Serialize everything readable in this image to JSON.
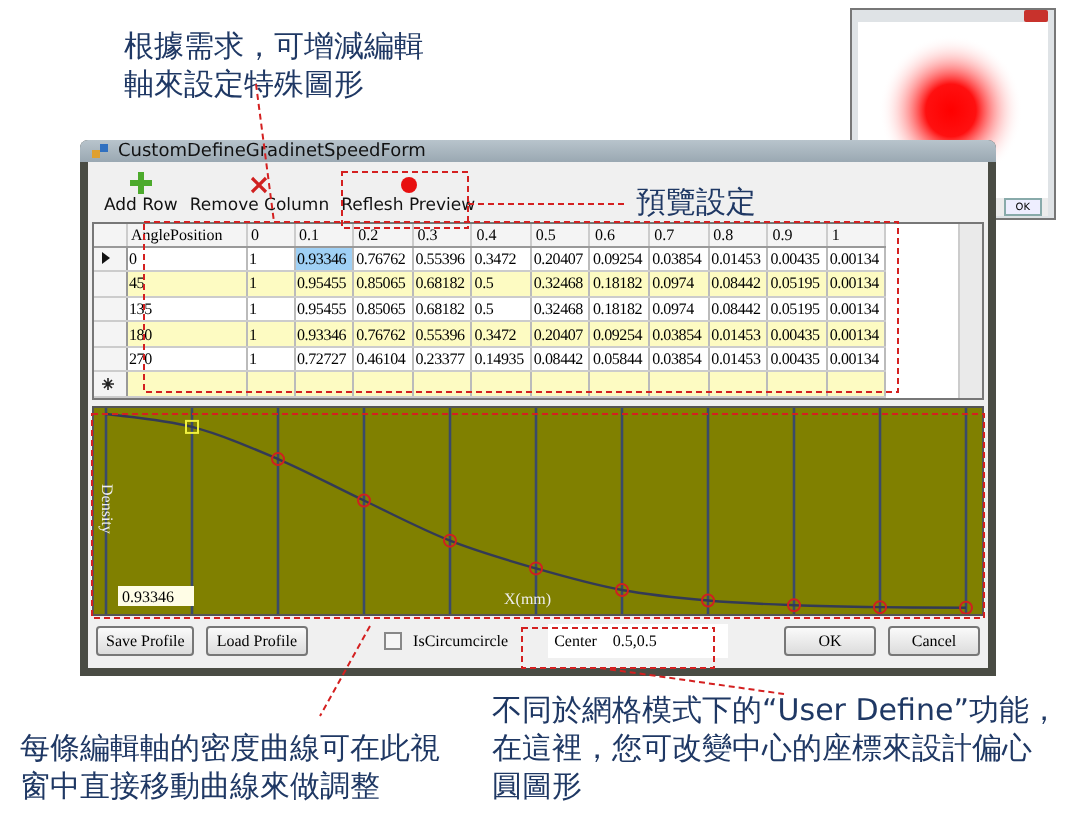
{
  "main_window": {
    "title": "CustomDefineGradinetSpeedForm",
    "toolbar": [
      {
        "label": "Add Row",
        "kind": "add"
      },
      {
        "label": "Remove Column",
        "kind": "remove"
      },
      {
        "label": "Reflesh Preview",
        "kind": "refresh"
      }
    ],
    "table": {
      "columns": [
        "AnglePosition",
        "0",
        "0.1",
        "0.2",
        "0.3",
        "0.4",
        "0.5",
        "0.6",
        "0.7",
        "0.8",
        "0.9",
        "1"
      ],
      "rows": [
        {
          "current": true,
          "cells": [
            {
              "text": "0",
              "selected": false
            },
            {
              "text": "1",
              "selected": false
            },
            {
              "text": "0.93346",
              "selected": true
            },
            {
              "text": "0.76762",
              "selected": false
            },
            {
              "text": "0.55396",
              "selected": false
            },
            {
              "text": "0.3472",
              "selected": false
            },
            {
              "text": "0.20407",
              "selected": false
            },
            {
              "text": "0.09254",
              "selected": false
            },
            {
              "text": "0.03854",
              "selected": false
            },
            {
              "text": "0.01453",
              "selected": false
            },
            {
              "text": "0.00435",
              "selected": false
            },
            {
              "text": "0.00134",
              "selected": false
            }
          ]
        },
        {
          "current": false,
          "cells": [
            {
              "text": "45",
              "selected": false
            },
            {
              "text": "1",
              "selected": false
            },
            {
              "text": "0.95455",
              "selected": false
            },
            {
              "text": "0.85065",
              "selected": false
            },
            {
              "text": "0.68182",
              "selected": false
            },
            {
              "text": "0.5",
              "selected": false
            },
            {
              "text": "0.32468",
              "selected": false
            },
            {
              "text": "0.18182",
              "selected": false
            },
            {
              "text": "0.0974",
              "selected": false
            },
            {
              "text": "0.08442",
              "selected": false
            },
            {
              "text": "0.05195",
              "selected": false
            },
            {
              "text": "0.00134",
              "selected": false
            }
          ]
        },
        {
          "current": false,
          "cells": [
            {
              "text": "135",
              "selected": false
            },
            {
              "text": "1",
              "selected": false
            },
            {
              "text": "0.95455",
              "selected": false
            },
            {
              "text": "0.85065",
              "selected": false
            },
            {
              "text": "0.68182",
              "selected": false
            },
            {
              "text": "0.5",
              "selected": false
            },
            {
              "text": "0.32468",
              "selected": false
            },
            {
              "text": "0.18182",
              "selected": false
            },
            {
              "text": "0.0974",
              "selected": false
            },
            {
              "text": "0.08442",
              "selected": false
            },
            {
              "text": "0.05195",
              "selected": false
            },
            {
              "text": "0.00134",
              "selected": false
            }
          ]
        },
        {
          "current": false,
          "cells": [
            {
              "text": "180",
              "selected": false
            },
            {
              "text": "1",
              "selected": false
            },
            {
              "text": "0.93346",
              "selected": false
            },
            {
              "text": "0.76762",
              "selected": false
            },
            {
              "text": "0.55396",
              "selected": false
            },
            {
              "text": "0.3472",
              "selected": false
            },
            {
              "text": "0.20407",
              "selected": false
            },
            {
              "text": "0.09254",
              "selected": false
            },
            {
              "text": "0.03854",
              "selected": false
            },
            {
              "text": "0.01453",
              "selected": false
            },
            {
              "text": "0.00435",
              "selected": false
            },
            {
              "text": "0.00134",
              "selected": false
            }
          ]
        },
        {
          "current": false,
          "cells": [
            {
              "text": "270",
              "selected": false
            },
            {
              "text": "1",
              "selected": false
            },
            {
              "text": "0.72727",
              "selected": false
            },
            {
              "text": "0.46104",
              "selected": false
            },
            {
              "text": "0.23377",
              "selected": false
            },
            {
              "text": "0.14935",
              "selected": false
            },
            {
              "text": "0.08442",
              "selected": false
            },
            {
              "text": "0.05844",
              "selected": false
            },
            {
              "text": "0.03854",
              "selected": false
            },
            {
              "text": "0.01453",
              "selected": false
            },
            {
              "text": "0.00435",
              "selected": false
            },
            {
              "text": "0.00134",
              "selected": false
            }
          ]
        }
      ]
    },
    "plot": {
      "ylabel": "Density",
      "xlabel": "X(mm)",
      "value_field": "0.93346"
    },
    "footer": {
      "left_buttons": [
        "Save Profile",
        "Load Profile"
      ],
      "checkbox": {
        "label": "IsCircumcircle",
        "checked": false
      },
      "center": {
        "label": "Center",
        "value": "0.5,0.5"
      },
      "right_buttons": [
        "OK",
        "Cancel"
      ]
    }
  },
  "preview_window": {
    "button": "OK"
  },
  "annotations": [
    {
      "kind": "top",
      "text": "根據需求，可增減編輯軸來設定特殊圖形"
    },
    {
      "kind": "preview",
      "text": "預覽設定"
    },
    {
      "kind": "bottom_left",
      "text": "每條編輯軸的密度曲線可在此視窗中直接移動曲線來做調整"
    },
    {
      "kind": "bottom_right",
      "text": "不同於網格模式下的“User Define”功能，在這裡，您可改變中心的座標來設計偏心圓圖形"
    }
  ]
}
